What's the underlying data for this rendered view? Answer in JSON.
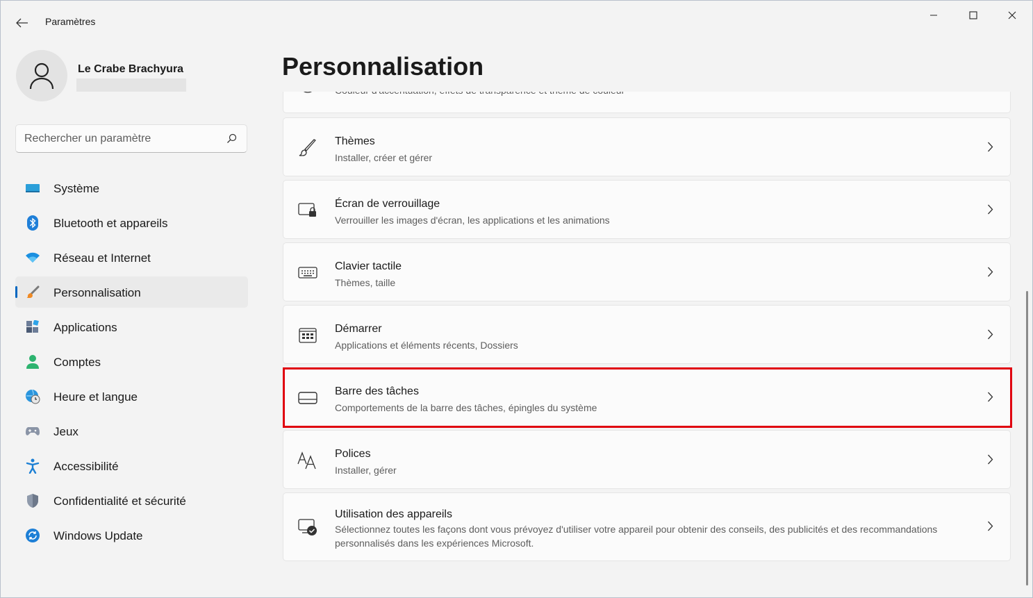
{
  "window": {
    "title": "Paramètres"
  },
  "profile": {
    "name": "Le Crabe Brachyura"
  },
  "search": {
    "placeholder": "Rechercher un paramètre"
  },
  "sidebar": {
    "items": [
      {
        "label": "Système",
        "icon": "system-icon"
      },
      {
        "label": "Bluetooth et appareils",
        "icon": "bluetooth-icon"
      },
      {
        "label": "Réseau et Internet",
        "icon": "wifi-icon"
      },
      {
        "label": "Personnalisation",
        "icon": "brush-icon",
        "active": true
      },
      {
        "label": "Applications",
        "icon": "apps-icon"
      },
      {
        "label": "Comptes",
        "icon": "account-icon"
      },
      {
        "label": "Heure et langue",
        "icon": "globe-clock-icon"
      },
      {
        "label": "Jeux",
        "icon": "gamepad-icon"
      },
      {
        "label": "Accessibilité",
        "icon": "accessibility-icon"
      },
      {
        "label": "Confidentialité et sécurité",
        "icon": "shield-icon"
      },
      {
        "label": "Windows Update",
        "icon": "update-icon"
      }
    ]
  },
  "main": {
    "title": "Personnalisation",
    "cards": [
      {
        "title": "",
        "subtitle": "Couleur d'accentuation, effets de transparence et thème de couleur",
        "icon": "palette-icon"
      },
      {
        "title": "Thèmes",
        "subtitle": "Installer, créer et gérer",
        "icon": "brush-icon"
      },
      {
        "title": "Écran de verrouillage",
        "subtitle": "Verrouiller les images d'écran, les applications et les animations",
        "icon": "lock-screen-icon"
      },
      {
        "title": "Clavier tactile",
        "subtitle": "Thèmes, taille",
        "icon": "keyboard-icon"
      },
      {
        "title": "Démarrer",
        "subtitle": "Applications et éléments récents, Dossiers",
        "icon": "start-icon"
      },
      {
        "title": "Barre des tâches",
        "subtitle": "Comportements de la barre des tâches, épingles du système",
        "icon": "taskbar-icon",
        "highlighted": true
      },
      {
        "title": "Polices",
        "subtitle": "Installer, gérer",
        "icon": "font-icon"
      },
      {
        "title": "Utilisation des appareils",
        "subtitle": "Sélectionnez toutes les façons dont vous prévoyez d'utiliser votre appareil pour obtenir des conseils, des publicités et des recommandations personnalisés dans les expériences Microsoft.",
        "icon": "device-usage-icon"
      }
    ]
  },
  "colors": {
    "accent": "#0067c0",
    "highlight_border": "#e0000f"
  }
}
